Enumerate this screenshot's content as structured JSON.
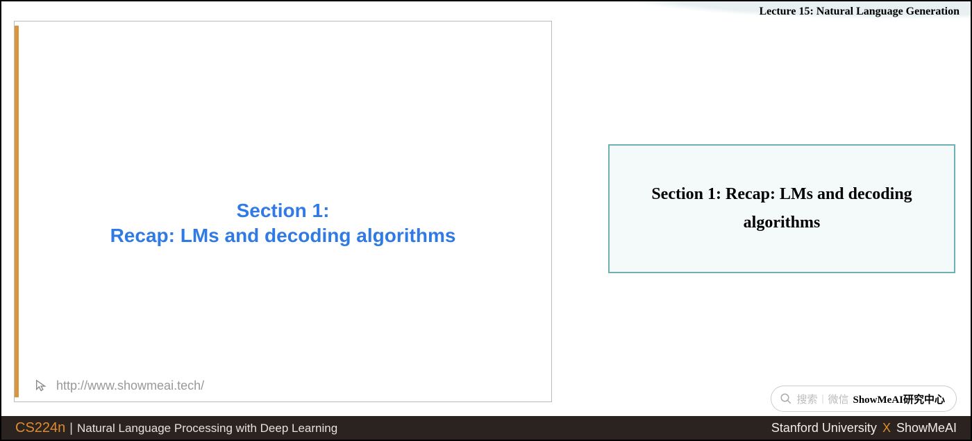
{
  "header": {
    "lecture_title": "Lecture 15: Natural Language Generation"
  },
  "slide": {
    "title_line1": "Section 1:",
    "title_line2": "Recap: LMs and decoding algorithms",
    "footer_url": "http://www.showmeai.tech/"
  },
  "callout": {
    "text": "Section 1: Recap: LMs and decoding algorithms"
  },
  "search": {
    "hint": "搜索",
    "sep_label": "微信",
    "brand": "ShowMeAI研究中心"
  },
  "footer": {
    "course_code": "CS224n",
    "course_name": "Natural Language Processing with Deep Learning",
    "institution": "Stanford University",
    "x": "X",
    "partner": "ShowMeAI"
  }
}
